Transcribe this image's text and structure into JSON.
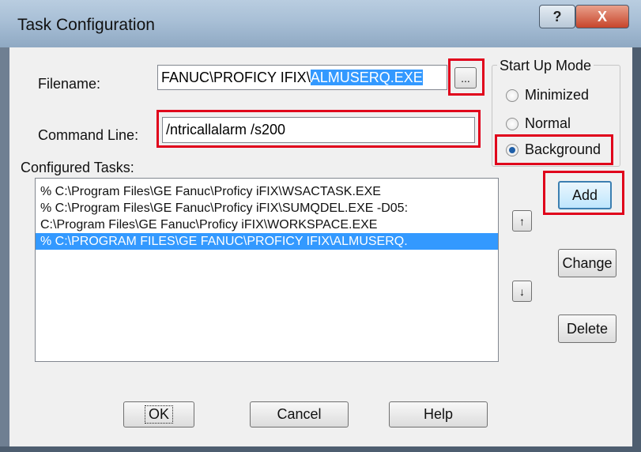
{
  "window": {
    "title": "Task Configuration",
    "help_glyph": "?",
    "close_glyph": "X"
  },
  "filename": {
    "label": "Filename:",
    "value_prefix": "FANUC\\PROFICY IFIX\\",
    "value_selected": "ALMUSERQ.EXE",
    "browse_label": "..."
  },
  "command_line": {
    "label": "Command Line:",
    "value": "/ntricallalarm /s200"
  },
  "configured_tasks": {
    "label": "Configured Tasks:",
    "items": [
      "% C:\\Program Files\\GE Fanuc\\Proficy iFIX\\WSACTASK.EXE",
      "% C:\\Program Files\\GE Fanuc\\Proficy iFIX\\SUMQDEL.EXE  -D05:",
      "  C:\\Program Files\\GE Fanuc\\Proficy iFIX\\WORKSPACE.EXE",
      "% C:\\PROGRAM FILES\\GE FANUC\\PROFICY IFIX\\ALMUSERQ."
    ],
    "selected_index": 3
  },
  "start_up_mode": {
    "title": "Start Up Mode",
    "options": [
      "Minimized",
      "Normal",
      "Background"
    ],
    "selected": "Background"
  },
  "buttons": {
    "add": "Add",
    "change": "Change",
    "delete": "Delete",
    "up": "↑",
    "down": "↓",
    "ok": "OK",
    "cancel": "Cancel",
    "help": "Help"
  },
  "colors": {
    "highlight_box": "#e0001b",
    "selection": "#3399ff"
  }
}
